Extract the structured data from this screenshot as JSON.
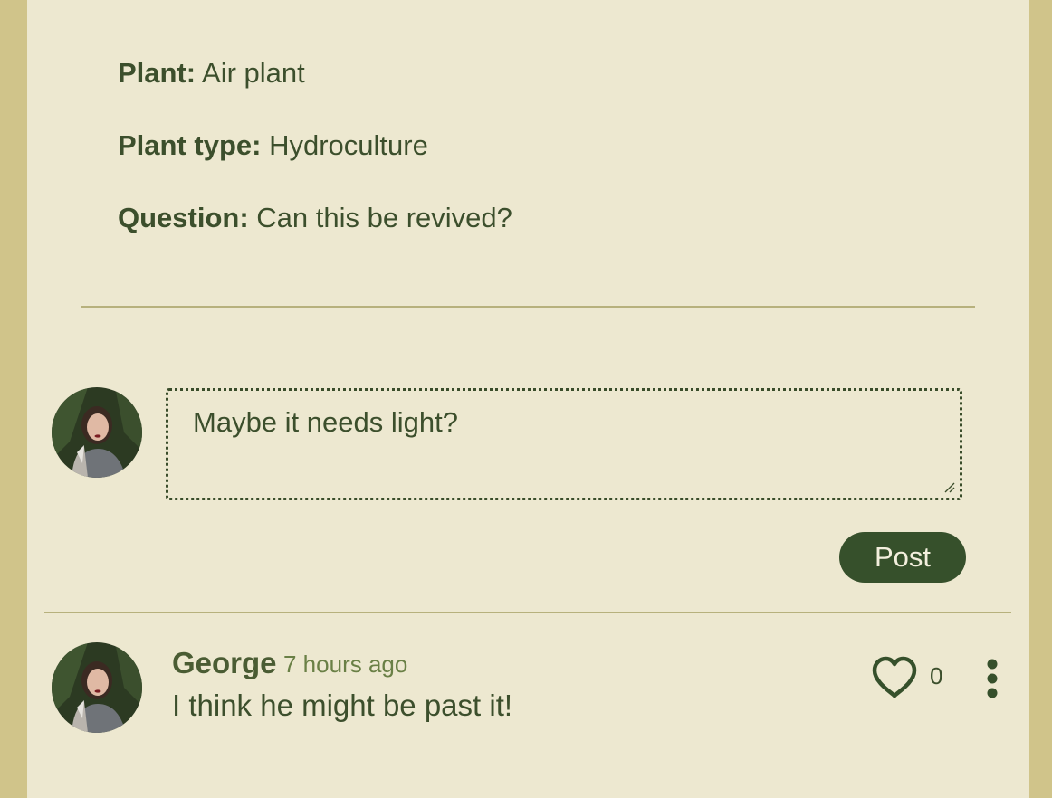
{
  "post": {
    "plant_label": "Plant:",
    "plant_value": "Air plant",
    "plant_type_label": "Plant type:",
    "plant_type_value": "Hydroculture",
    "question_label": "Question:",
    "question_value": "Can this be revived?"
  },
  "compose": {
    "text": "Maybe it needs light?",
    "post_label": "Post",
    "avatar_icon": "user-avatar"
  },
  "comments": [
    {
      "author": "George",
      "time": "7 hours ago",
      "text": "I think he might be past it!",
      "likes": "0",
      "like_icon": "heart-icon",
      "menu_icon": "more-vertical-icon"
    }
  ],
  "colors": {
    "background": "#d0c48a",
    "panel": "#ede8d0",
    "accent": "#36502b",
    "divider": "#b7b17d"
  }
}
